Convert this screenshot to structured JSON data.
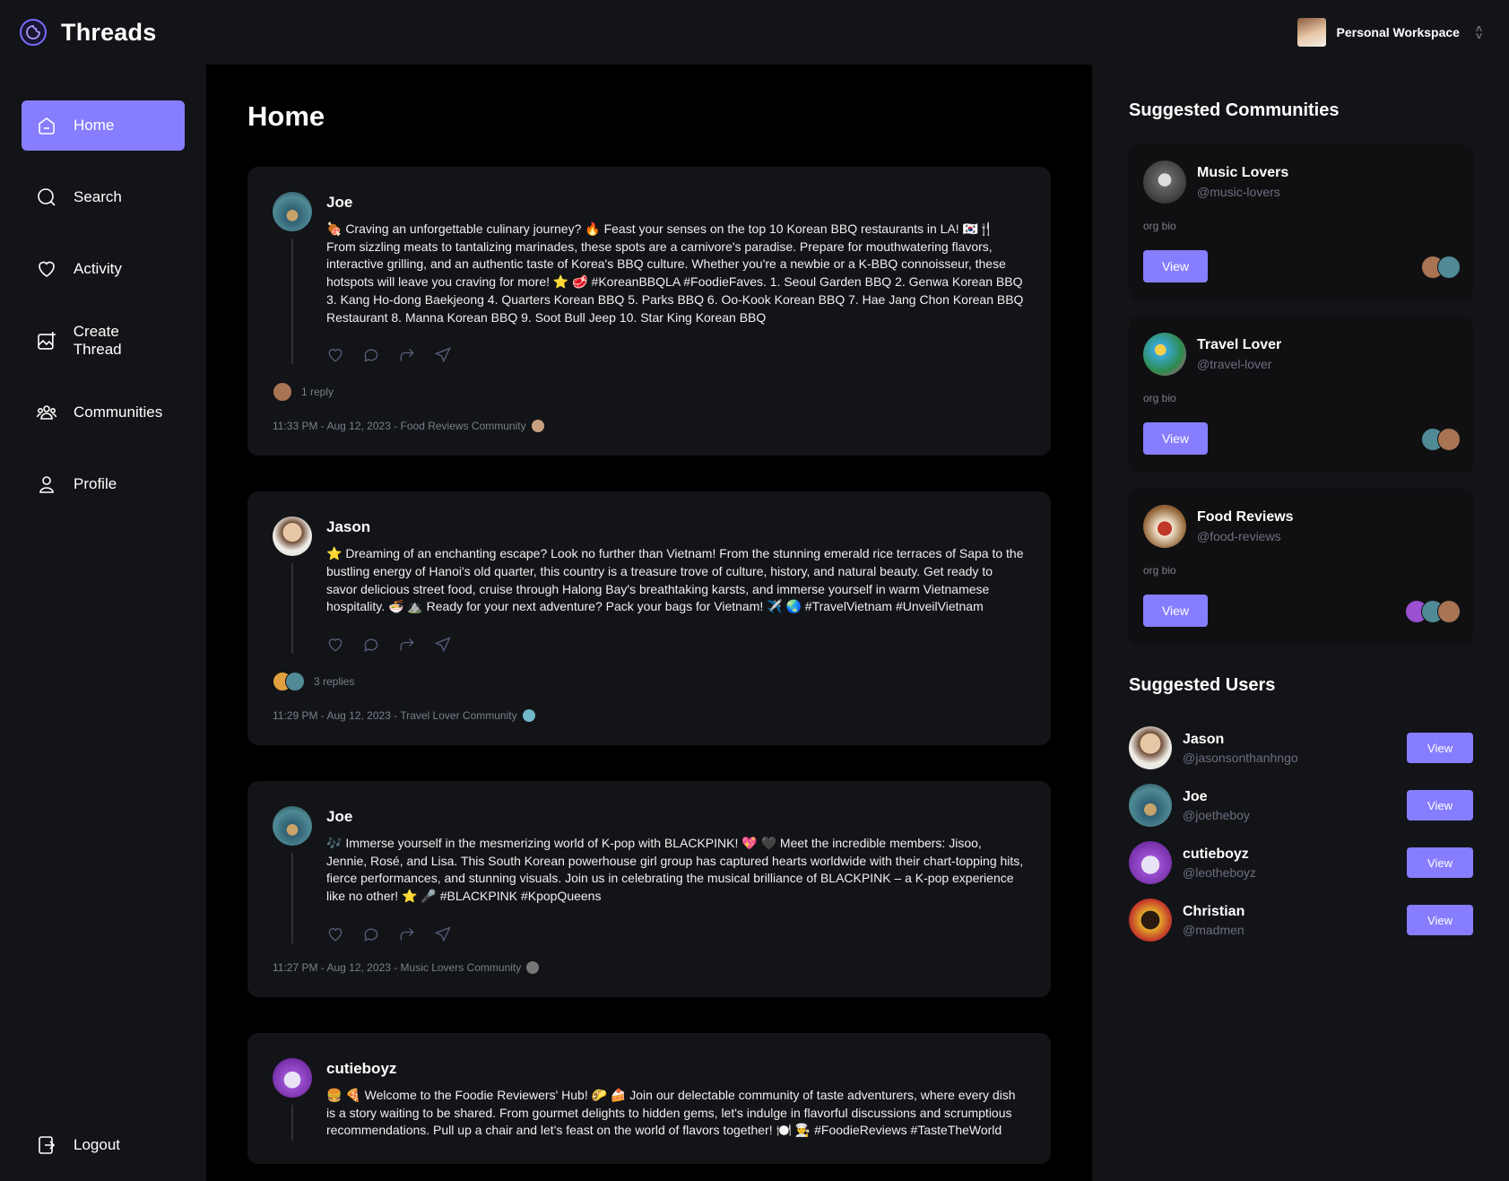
{
  "app": {
    "title": "Threads",
    "workspace": "Personal Workspace",
    "accent": "#877eff"
  },
  "nav": {
    "items": [
      {
        "label": "Home",
        "icon": "home-icon",
        "active": true
      },
      {
        "label": "Search",
        "icon": "search-icon"
      },
      {
        "label": "Activity",
        "icon": "heart-icon"
      },
      {
        "label": "Create Thread",
        "icon": "create-thread-icon"
      },
      {
        "label": "Communities",
        "icon": "communities-icon"
      },
      {
        "label": "Profile",
        "icon": "user-icon"
      }
    ],
    "logout": "Logout"
  },
  "main": {
    "title": "Home",
    "threads": [
      {
        "author": "Joe",
        "content": "🍖 Craving an unforgettable culinary journey? 🔥 Feast your senses on the top 10 Korean BBQ restaurants in LA! 🇰🇷🍴 From sizzling meats to tantalizing marinades, these spots are a carnivore's paradise. Prepare for mouthwatering flavors, interactive grilling, and an authentic taste of Korea's BBQ culture. Whether you're a newbie or a K-BBQ connoisseur, these hotspots will leave you craving for more! ⭐ 🥩 #KoreanBBQLA #FoodieFaves. 1. Seoul Garden BBQ 2. Genwa Korean BBQ 3. Kang Ho-dong Baekjeong 4. Quarters Korean BBQ 5. Parks BBQ 6. Oo-Kook Korean BBQ 7. Hae Jang Chon Korean BBQ Restaurant 8. Manna Korean BBQ 9. Soot Bull Jeep 10. Star King Korean BBQ",
        "replies": "1 reply",
        "meta": "11:33 PM - Aug 12, 2023 - Food Reviews Community"
      },
      {
        "author": "Jason",
        "content": "⭐ Dreaming of an enchanting escape? Look no further than Vietnam! From the stunning emerald rice terraces of Sapa to the bustling energy of Hanoi's old quarter, this country is a treasure trove of culture, history, and natural beauty. Get ready to savor delicious street food, cruise through Halong Bay's breathtaking karsts, and immerse yourself in warm Vietnamese hospitality. 🍜 ⛰️ Ready for your next adventure? Pack your bags for Vietnam! ✈️ 🌏 #TravelVietnam #UnveilVietnam",
        "replies": "3 replies",
        "meta": "11:29 PM - Aug 12, 2023 - Travel Lover Community"
      },
      {
        "author": "Joe",
        "content": "🎶 Immerse yourself in the mesmerizing world of K-pop with BLACKPINK! 💖 🖤 Meet the incredible members: Jisoo, Jennie, Rosé, and Lisa. This South Korean powerhouse girl group has captured hearts worldwide with their chart-topping hits, fierce performances, and stunning visuals. Join us in celebrating the musical brilliance of BLACKPINK – a K-pop experience like no other! ⭐ 🎤 #BLACKPINK #KpopQueens",
        "replies": "",
        "meta": "11:27 PM - Aug 12, 2023 - Music Lovers Community"
      },
      {
        "author": "cutieboyz",
        "content": "🍔 🍕 Welcome to the Foodie Reviewers' Hub! 🌮 🍰 Join our delectable community of taste adventurers, where every dish is a story waiting to be shared. From gourmet delights to hidden gems, let's indulge in flavorful discussions and scrumptious recommendations. Pull up a chair and let's feast on the world of flavors together! 🍽️ 👨‍🍳 #FoodieReviews #TasteTheWorld",
        "replies": "",
        "meta": ""
      }
    ]
  },
  "rightbar": {
    "communities_title": "Suggested Communities",
    "communities": [
      {
        "name": "Music Lovers",
        "handle": "@music-lovers",
        "bio": "org bio",
        "button": "View"
      },
      {
        "name": "Travel Lover",
        "handle": "@travel-lover",
        "bio": "org bio",
        "button": "View"
      },
      {
        "name": "Food Reviews",
        "handle": "@food-reviews",
        "bio": "org bio",
        "button": "View"
      }
    ],
    "users_title": "Suggested Users",
    "users": [
      {
        "name": "Jason",
        "handle": "@jasonsonthanhngo",
        "button": "View"
      },
      {
        "name": "Joe",
        "handle": "@joetheboy",
        "button": "View"
      },
      {
        "name": "cutieboyz",
        "handle": "@leotheboyz",
        "button": "View"
      },
      {
        "name": "Christian",
        "handle": "@madmen",
        "button": "View"
      }
    ]
  }
}
